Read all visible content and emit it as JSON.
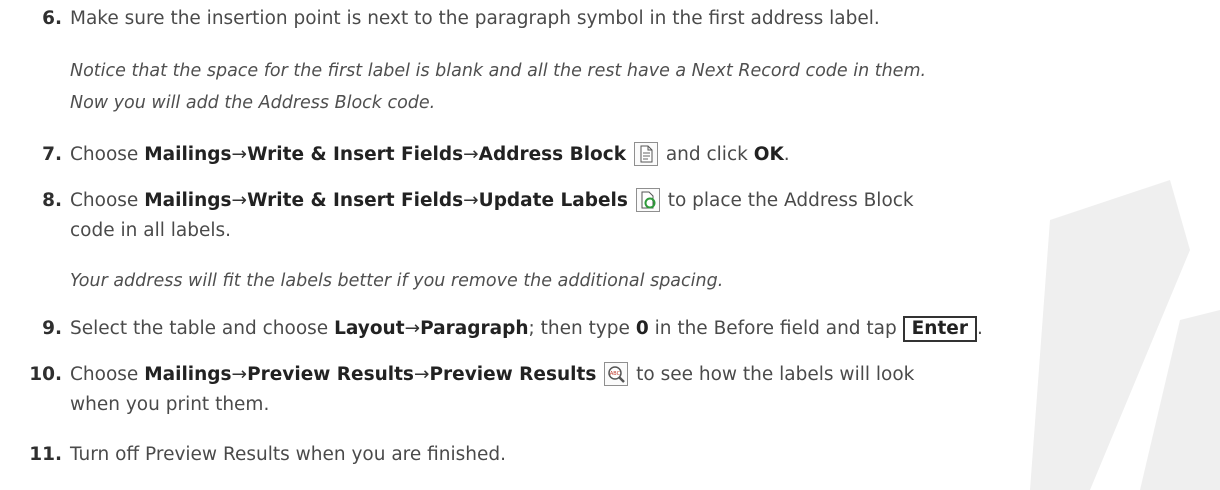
{
  "step6": {
    "num": "6.",
    "text": "Make sure the insertion point is next to the paragraph symbol in the first address label.",
    "note_line1": "Notice that the space for the first label is blank and all the rest have a Next Record code in them.",
    "note_line2": "Now you will add the Address Block code."
  },
  "step7": {
    "num": "7.",
    "choose": "Choose",
    "tab": "Mailings",
    "group": "Write & Insert Fields",
    "command": "Address Block",
    "tail": "and click",
    "button": "OK",
    "end": "."
  },
  "step8": {
    "num": "8.",
    "choose": "Choose",
    "tab": "Mailings",
    "group": "Write & Insert Fields",
    "command": "Update Labels",
    "tail": "to place the Address Block",
    "line2": "code in all labels.",
    "note": "Your address will fit the labels better if you remove the additional spacing."
  },
  "step9": {
    "num": "9.",
    "pre": "Select the table and choose",
    "tab": "Layout",
    "group": "Paragraph",
    "mid": "; then type",
    "value": "0",
    "post": "in the Before field and tap",
    "key": "Enter",
    "end": "."
  },
  "step10": {
    "num": "10.",
    "choose": "Choose",
    "tab": "Mailings",
    "group": "Preview Results",
    "command": "Preview Results",
    "tail": "to see how the labels will look",
    "line2": "when you print them."
  },
  "step11": {
    "num": "11.",
    "text": "Turn off Preview Results when you are finished."
  },
  "arrow": "→",
  "icons": {
    "address_block": "address-block-icon",
    "update_labels": "update-labels-icon",
    "preview_results": "preview-results-icon"
  },
  "colors": {
    "watermark": "#e8e8e8",
    "text": "#4a4a4a"
  }
}
